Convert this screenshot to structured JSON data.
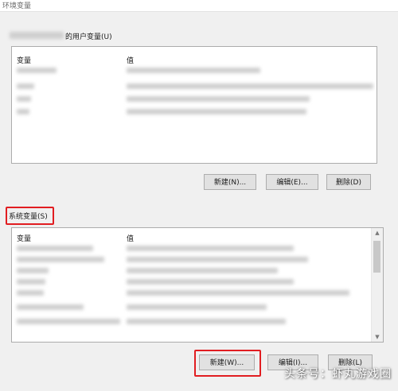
{
  "window": {
    "title": "环境变量"
  },
  "user_section": {
    "label": "的用户变量(U)",
    "col_variable": "变量",
    "col_value": "值",
    "buttons": {
      "new": "新建(N)...",
      "edit": "编辑(E)...",
      "delete": "删除(D)"
    }
  },
  "system_section": {
    "label": "系统变量(S)",
    "col_variable": "变量",
    "col_value": "值",
    "buttons": {
      "new": "新建(W)...",
      "edit": "编辑(I)...",
      "delete": "删除(L)"
    }
  },
  "watermark": "头条号：虾丸游戏圈",
  "colors": {
    "highlight": "#e11d21",
    "button_bg": "#e1e1e1",
    "list_bg": "#ffffff",
    "window_bg": "#f0f0f0"
  }
}
